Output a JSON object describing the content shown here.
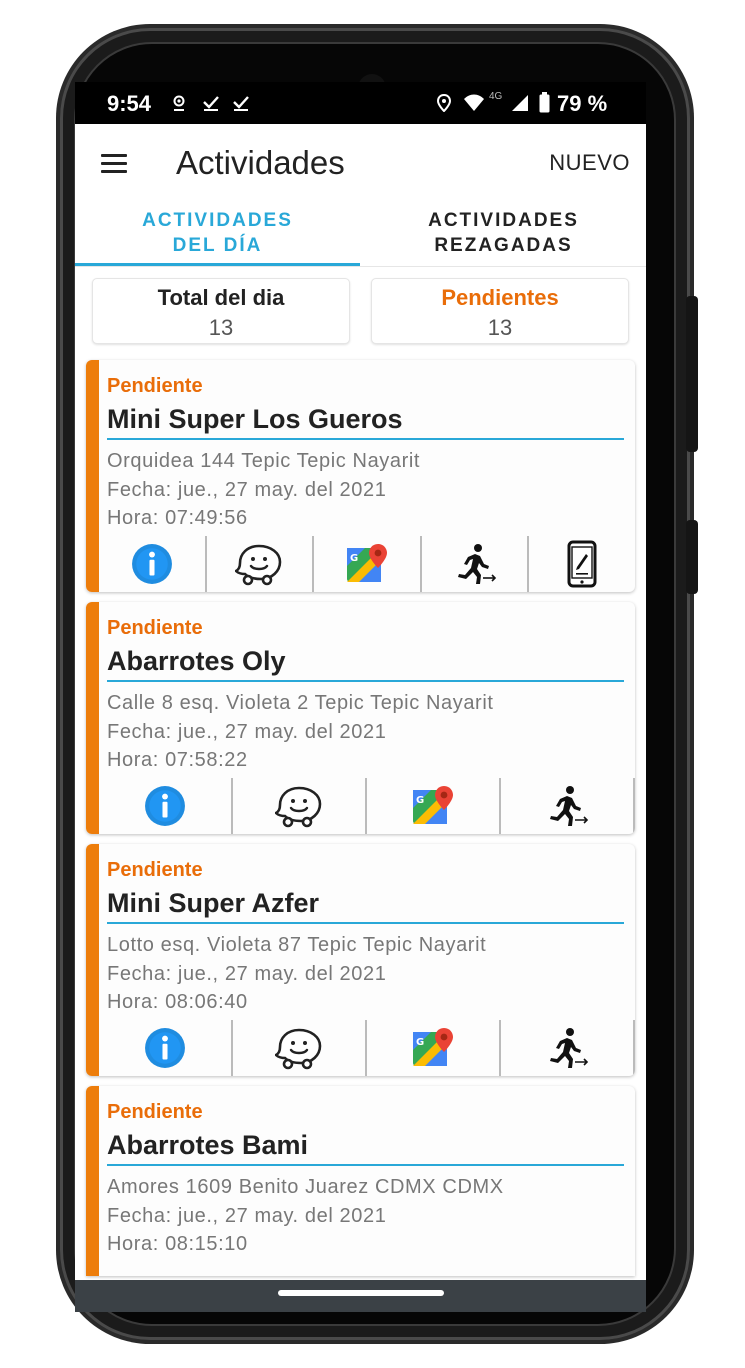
{
  "status_bar": {
    "time": "9:54",
    "battery": "79 %",
    "network": "4G",
    "left_icons": [
      "location-icon",
      "check-icon",
      "check-icon"
    ],
    "right_icons": [
      "location-icon",
      "wifi-icon",
      "signal-icon",
      "battery-icon"
    ]
  },
  "app_bar": {
    "title": "Actividades",
    "new_label": "NUEVO"
  },
  "tabs": [
    {
      "label_line1": "ACTIVIDADES",
      "label_line2": "DEL DÍA",
      "active": true
    },
    {
      "label_line1": "ACTIVIDADES",
      "label_line2": "REZAGADAS",
      "active": false
    }
  ],
  "stats": {
    "total": {
      "label": "Total del dia",
      "value": "13"
    },
    "pending": {
      "label": "Pendientes",
      "value": "13"
    }
  },
  "activities": [
    {
      "status": "Pendiente",
      "name": "Mini Super Los Gueros",
      "address": "Orquidea 144 Tepic Tepic Nayarit",
      "date": "Fecha:  jue., 27 may. del  2021",
      "time": "Hora: 07:49:56",
      "actions": [
        "info-icon",
        "waze-icon",
        "google-maps-icon",
        "check-in-icon",
        "phone-edit-icon"
      ]
    },
    {
      "status": "Pendiente",
      "name": "Abarrotes Oly",
      "address": "Calle 8 esq. Violeta 2 Tepic Tepic Nayarit",
      "date": "Fecha:  jue., 27 may. del  2021",
      "time": "Hora: 07:58:22",
      "actions": [
        "info-icon",
        "waze-icon",
        "google-maps-icon",
        "check-in-icon"
      ]
    },
    {
      "status": "Pendiente",
      "name": "Mini Super Azfer",
      "address": "Lotto esq. Violeta 87 Tepic Tepic Nayarit",
      "date": "Fecha:  jue., 27 may. del  2021",
      "time": "Hora: 08:06:40",
      "actions": [
        "info-icon",
        "waze-icon",
        "google-maps-icon",
        "check-in-icon"
      ]
    },
    {
      "status": "Pendiente",
      "name": "Abarrotes Bami",
      "address": "Amores 1609 Benito Juarez CDMX CDMX",
      "date": "Fecha:  jue., 27 may. del  2021",
      "time": "Hora: 08:15:10",
      "actions": []
    }
  ],
  "colors": {
    "accent": "#29a8d8",
    "pending": "#ed7d0b",
    "text": "#222222",
    "secondary_text": "#777777"
  }
}
